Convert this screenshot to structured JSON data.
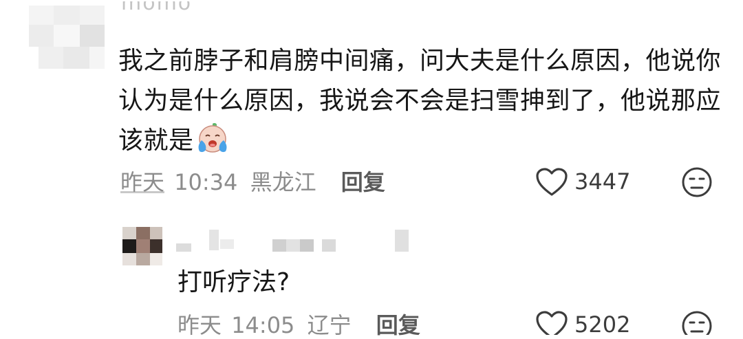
{
  "comments": [
    {
      "username": "momo",
      "text": "我之前脖子和肩膀中间痛，问大夫是什么原因，他说你认为是什么原因，我说会不会是扫雪抻到了，他说那应该就是",
      "emoji": "crying-face-emoji",
      "date": "昨天",
      "time": "10:34",
      "location": "黑龙江",
      "reply_label": "回复",
      "likes": "3447"
    },
    {
      "username": "",
      "text": "打听疗法?",
      "date": "昨天",
      "time": "14:05",
      "location": "辽宁",
      "reply_label": "回复",
      "likes": "5202"
    }
  ],
  "colors": {
    "body_text": "#161616",
    "meta_text": "#8c8c8c",
    "reply_text": "#5a5a5a",
    "icon_stroke": "#3c3c3c"
  },
  "icons": [
    "heart-icon",
    "dislike-face-icon",
    "crying-face-emoji"
  ]
}
